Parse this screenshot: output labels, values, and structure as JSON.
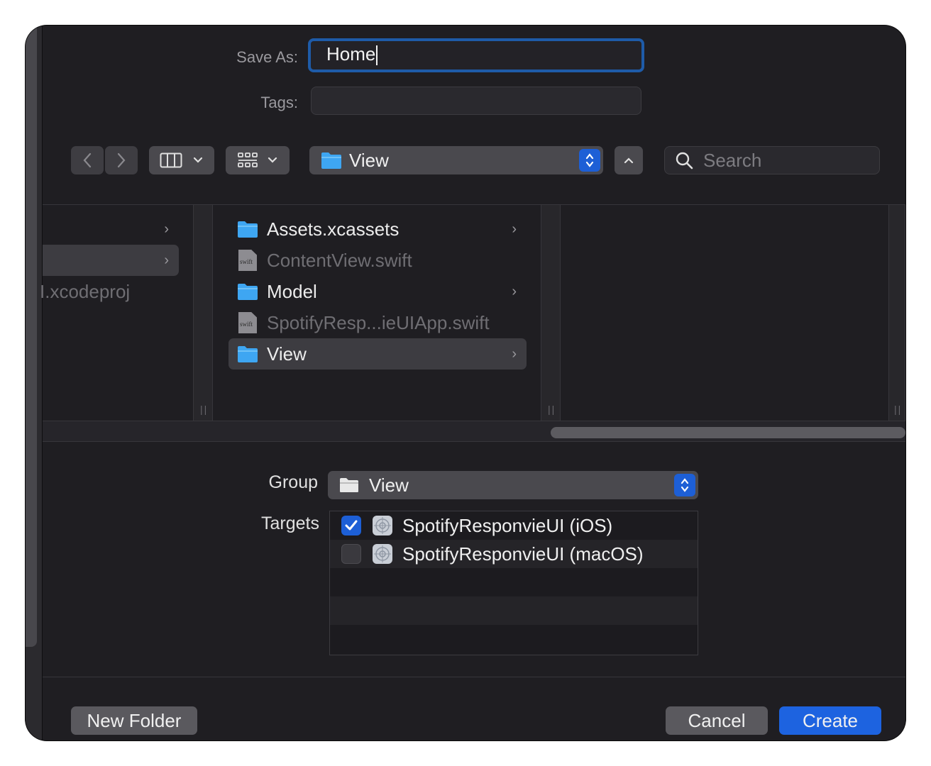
{
  "save_as": {
    "label": "Save As:",
    "value": "Home"
  },
  "tags": {
    "label": "Tags:",
    "value": ""
  },
  "toolbar": {
    "back_icon": "chevron-left-icon",
    "forward_icon": "chevron-right-icon",
    "view_mode_icon": "columns-view-icon",
    "group_mode_icon": "grid-icon",
    "location": "View",
    "search_placeholder": "Search"
  },
  "browser": {
    "col1": [
      {
        "label": "",
        "has_children": true
      },
      {
        "label": "",
        "has_children": true,
        "selected": true
      },
      {
        "label": "I.xcodeproj",
        "has_children": false
      }
    ],
    "col2": [
      {
        "label": "Assets.xcassets",
        "kind": "folder",
        "has_children": true,
        "enabled": true
      },
      {
        "label": "ContentView.swift",
        "kind": "swift",
        "has_children": false,
        "enabled": false
      },
      {
        "label": "Model",
        "kind": "folder",
        "has_children": true,
        "enabled": true
      },
      {
        "label": "SpotifyResp...ieUIApp.swift",
        "kind": "swift",
        "has_children": false,
        "enabled": false
      },
      {
        "label": "View",
        "kind": "folder",
        "has_children": true,
        "enabled": true,
        "selected": true
      }
    ],
    "file_badge": "swift"
  },
  "group": {
    "label": "Group",
    "value": "View"
  },
  "targets": {
    "label": "Targets",
    "items": [
      {
        "label": "SpotifyResponvieUI (iOS)",
        "checked": true
      },
      {
        "label": "SpotifyResponvieUI (macOS)",
        "checked": false
      }
    ]
  },
  "buttons": {
    "new_folder": "New Folder",
    "cancel": "Cancel",
    "create": "Create"
  },
  "colors": {
    "accent": "#1d63e0",
    "folder": "#3ea6f2",
    "background": "#1f1e22"
  }
}
